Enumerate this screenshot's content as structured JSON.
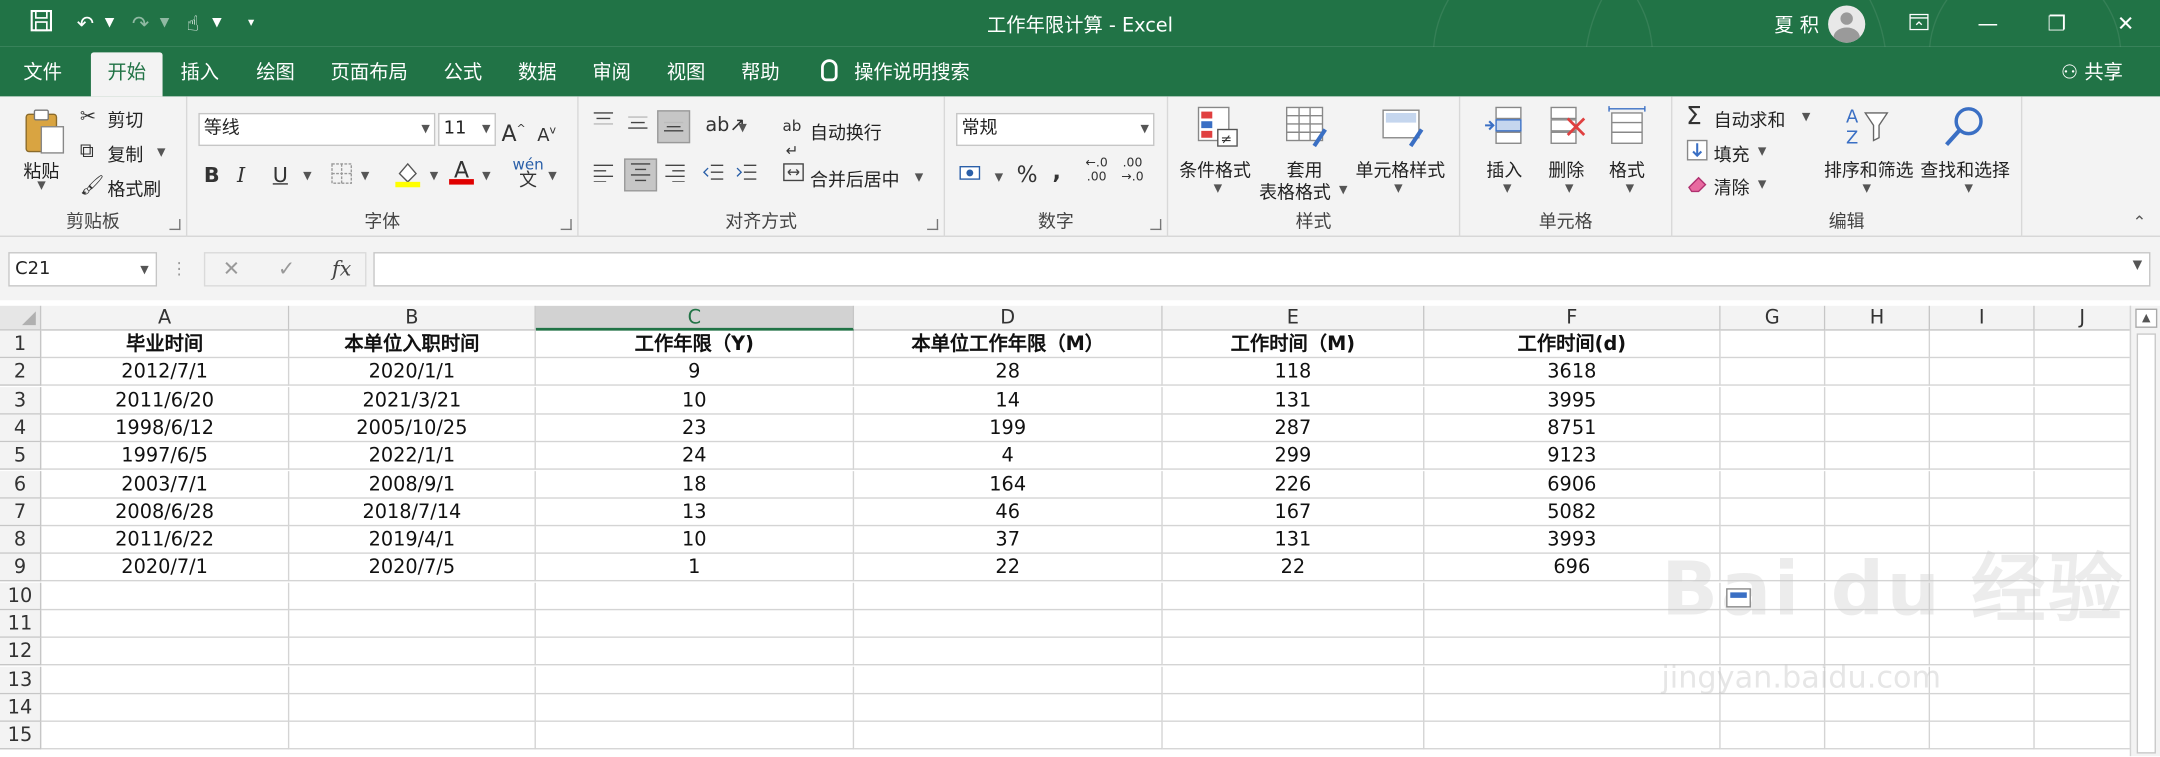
{
  "window": {
    "title": "工作年限计算 - Excel",
    "user_name": "夏 积"
  },
  "quick_access": {
    "icons": [
      "save-icon",
      "undo-icon",
      "redo-icon",
      "touch-mode-icon",
      "customize-icon"
    ]
  },
  "menu": {
    "tabs": [
      "文件",
      "开始",
      "插入",
      "绘图",
      "页面布局",
      "公式",
      "数据",
      "审阅",
      "视图",
      "帮助"
    ],
    "active": "开始",
    "tell_me": "操作说明搜索",
    "share": "共享"
  },
  "ribbon": {
    "clipboard": {
      "paste": "粘贴",
      "cut": "剪切",
      "copy": "复制",
      "format_painter": "格式刷",
      "label": "剪贴板"
    },
    "font": {
      "name": "等线",
      "size": "11",
      "label": "字体",
      "bold": "B",
      "italic": "I",
      "underline": "U"
    },
    "alignment": {
      "wrap": "自动换行",
      "merge": "合并后居中",
      "label": "对齐方式"
    },
    "number": {
      "format": "常规",
      "label": "数字",
      "percent": "%",
      "comma": ","
    },
    "styles": {
      "conditional": "条件格式",
      "table_line1": "套用",
      "table_line2": "表格格式",
      "cell_styles": "单元格样式",
      "label": "样式"
    },
    "cells": {
      "insert": "插入",
      "delete": "删除",
      "format": "格式",
      "label": "单元格"
    },
    "editing": {
      "autosum": "自动求和",
      "fill": "填充",
      "clear": "清除",
      "sort": "排序和筛选",
      "find": "查找和选择",
      "label": "编辑"
    }
  },
  "formula_bar": {
    "name_box": "C21",
    "fx": "fx",
    "content": ""
  },
  "accent": "#217346",
  "sheet": {
    "columns": [
      "A",
      "B",
      "C",
      "D",
      "E",
      "F",
      "G",
      "H",
      "I",
      "J"
    ],
    "selected_column": "C",
    "rows": [
      "1",
      "2",
      "3",
      "4",
      "5",
      "6",
      "7",
      "8",
      "9",
      "10",
      "11",
      "12",
      "13",
      "14",
      "15"
    ],
    "data": [
      [
        "毕业时间",
        "本单位入职时间",
        "工作年限（Y)",
        "本单位工作年限（M）",
        "工作时间（M)",
        "工作时间(d)"
      ],
      [
        "2012/7/1",
        "2020/1/1",
        "9",
        "28",
        "118",
        "3618"
      ],
      [
        "2011/6/20",
        "2021/3/21",
        "10",
        "14",
        "131",
        "3995"
      ],
      [
        "1998/6/12",
        "2005/10/25",
        "23",
        "199",
        "287",
        "8751"
      ],
      [
        "1997/6/5",
        "2022/1/1",
        "24",
        "4",
        "299",
        "9123"
      ],
      [
        "2003/7/1",
        "2008/9/1",
        "18",
        "164",
        "226",
        "6906"
      ],
      [
        "2008/6/28",
        "2018/7/14",
        "13",
        "46",
        "167",
        "5082"
      ],
      [
        "2011/6/22",
        "2019/4/1",
        "10",
        "37",
        "131",
        "3993"
      ],
      [
        "2020/7/1",
        "2020/7/5",
        "1",
        "22",
        "22",
        "696"
      ]
    ]
  },
  "watermark": {
    "main": "Bai du 经验",
    "sub": "jingyan.baidu.com"
  }
}
